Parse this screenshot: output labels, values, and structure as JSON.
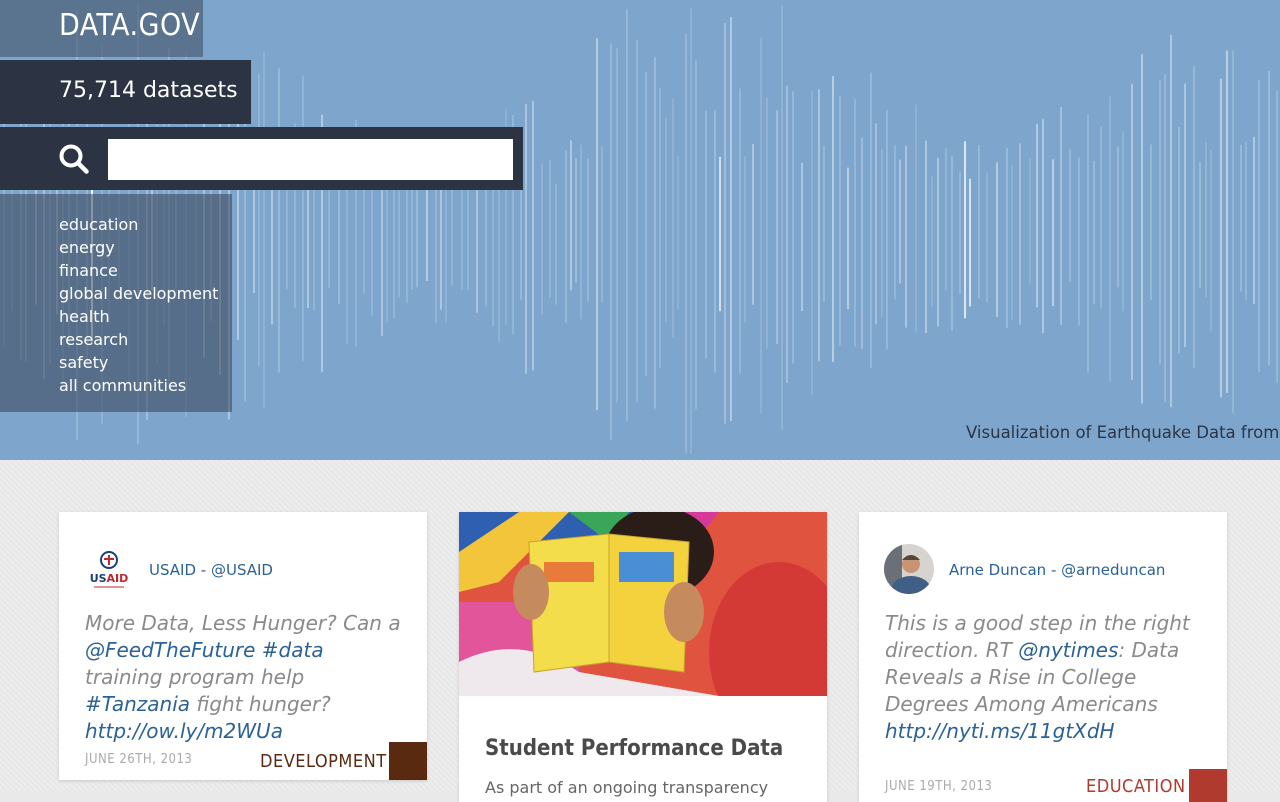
{
  "site": {
    "logo": "DATA.GOV",
    "dataset_count": "75,714 datasets",
    "search_placeholder": ""
  },
  "hero": {
    "communities": [
      "education",
      "energy",
      "finance",
      "global development",
      "health",
      "research",
      "safety",
      "all communities"
    ],
    "caption": "Visualization of Earthquake Data from U",
    "colors": {
      "background": "#7ea6cc",
      "panel": "#2c3443"
    }
  },
  "cards": [
    {
      "avatar_text": "USAID",
      "handle": "USAID - @USAID",
      "tweet": [
        {
          "t": "More Data, Less Hunger? Can a ",
          "link": false
        },
        {
          "t": "@FeedTheFuture",
          "link": true
        },
        {
          "t": " ",
          "link": false
        },
        {
          "t": "#data",
          "link": true
        },
        {
          "t": " training program help ",
          "link": false
        },
        {
          "t": "#Tanzania",
          "link": true
        },
        {
          "t": " fight hunger? ",
          "link": false
        },
        {
          "t": "http://ow.ly/m2WUa",
          "link": true
        }
      ],
      "date": "JUNE 26TH, 2013",
      "category": "DEVELOPMENT",
      "category_color": "#5a2a10"
    },
    {
      "image": "child-reading-photo",
      "title": "Student Performance Data",
      "text": "As part of an ongoing transparency"
    },
    {
      "handle": "Arne Duncan - @arneduncan",
      "tweet": [
        {
          "t": "This is a good step in the right direction. RT ",
          "link": false
        },
        {
          "t": "@nytimes",
          "link": true
        },
        {
          "t": ": Data Reveals a Rise in College Degrees Among Americans ",
          "link": false
        },
        {
          "t": "http://nyti.ms/11gtXdH",
          "link": true
        }
      ],
      "date": "JUNE 19TH, 2013",
      "category": "EDUCATION",
      "category_color": "#b03a2e"
    }
  ]
}
